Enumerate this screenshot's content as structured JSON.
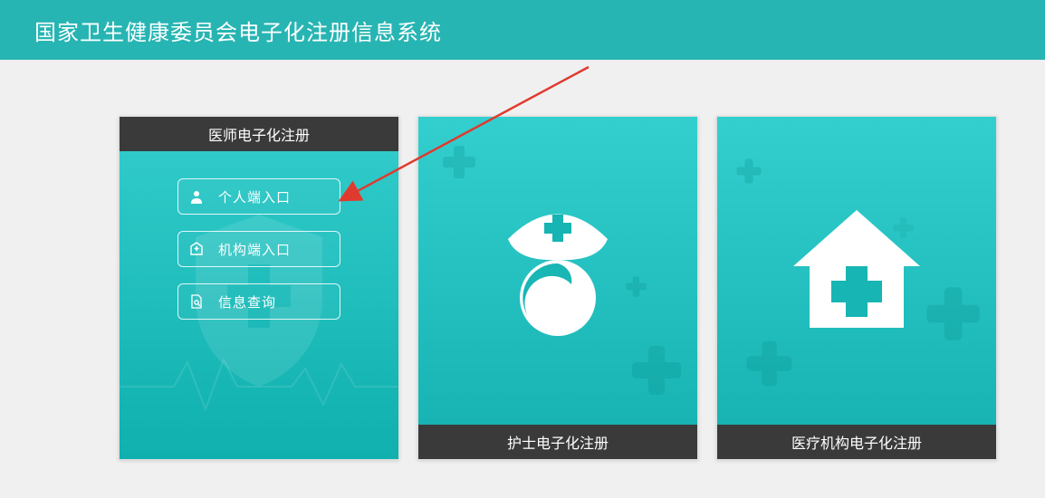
{
  "header": {
    "title": "国家卫生健康委员会电子化注册信息系统"
  },
  "cards": {
    "doctor": {
      "title": "医师电子化注册",
      "buttons": {
        "personal": "个人端入口",
        "org": "机构端入口",
        "query": "信息查询"
      }
    },
    "nurse": {
      "title": "护士电子化注册"
    },
    "institution": {
      "title": "医疗机构电子化注册"
    }
  }
}
